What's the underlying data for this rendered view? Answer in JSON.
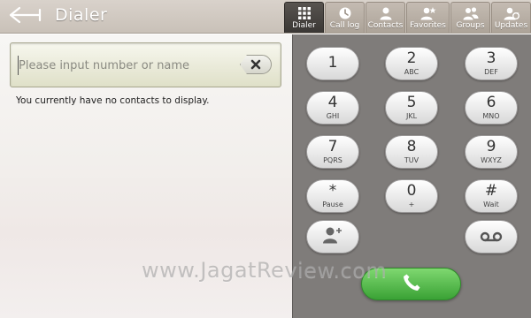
{
  "header": {
    "title": "Dialer",
    "back_icon": "back-arrow-icon"
  },
  "tabs": [
    {
      "label": "Dialer",
      "icon": "dialpad-grid-icon",
      "active": true
    },
    {
      "label": "Call log",
      "icon": "clock-icon",
      "active": false
    },
    {
      "label": "Contacts",
      "icon": "person-icon",
      "active": false
    },
    {
      "label": "Favorites",
      "icon": "person-star-icon",
      "active": false
    },
    {
      "label": "Groups",
      "icon": "people-icon",
      "active": false
    },
    {
      "label": "Updates",
      "icon": "person-refresh-icon",
      "active": false
    }
  ],
  "search": {
    "placeholder": "Please input number or name",
    "value": ""
  },
  "empty_message": "You currently have no contacts to display.",
  "keypad": [
    {
      "digit": "1",
      "letters": ""
    },
    {
      "digit": "2",
      "letters": "ABC"
    },
    {
      "digit": "3",
      "letters": "DEF"
    },
    {
      "digit": "4",
      "letters": "GHI"
    },
    {
      "digit": "5",
      "letters": "JKL"
    },
    {
      "digit": "6",
      "letters": "MNO"
    },
    {
      "digit": "7",
      "letters": "PQRS"
    },
    {
      "digit": "8",
      "letters": "TUV"
    },
    {
      "digit": "9",
      "letters": "WXYZ"
    },
    {
      "digit": "*",
      "letters": "Pause"
    },
    {
      "digit": "0",
      "letters": "+"
    },
    {
      "digit": "#",
      "letters": "Wait"
    }
  ],
  "actions": {
    "add_contact_icon": "add-contact-icon",
    "voicemail_icon": "voicemail-icon",
    "call_icon": "phone-handset-icon"
  },
  "watermark": "www.JagatReview.com",
  "colors": {
    "call_button": "#3aa235",
    "active_tab": "#3a3734",
    "keypad_background": "#7f7c7a"
  }
}
